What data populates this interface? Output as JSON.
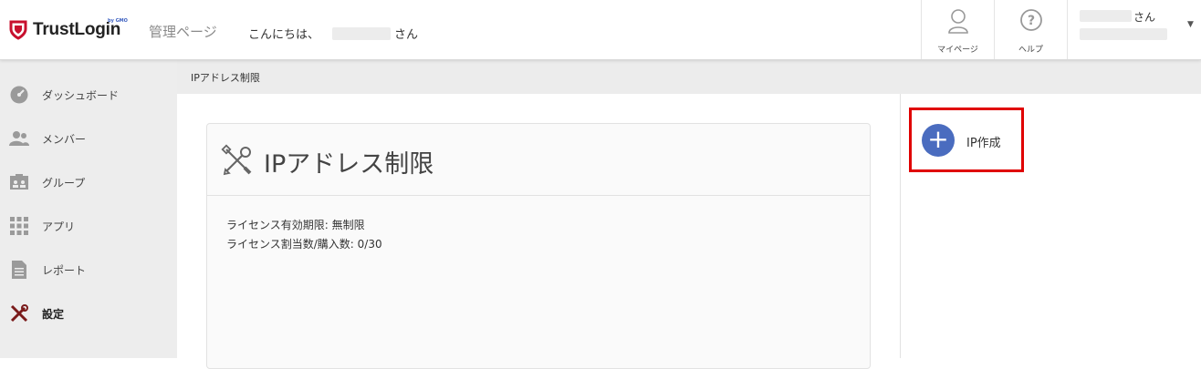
{
  "header": {
    "logo_text": "TrustLogin",
    "logo_sub": "by GMO",
    "admin_label": "管理ページ",
    "greeting_prefix": "こんにちは、",
    "greeting_suffix": "さん",
    "mypage_label": "マイページ",
    "help_label": "ヘルプ",
    "user_suffix": "さん"
  },
  "sidebar": {
    "items": [
      {
        "label": "ダッシュボード",
        "icon": "dashboard-icon"
      },
      {
        "label": "メンバー",
        "icon": "members-icon"
      },
      {
        "label": "グループ",
        "icon": "group-icon"
      },
      {
        "label": "アプリ",
        "icon": "apps-grid-icon"
      },
      {
        "label": "レポート",
        "icon": "report-icon"
      },
      {
        "label": "設定",
        "icon": "settings-tools-icon",
        "active": true
      }
    ]
  },
  "breadcrumb": "IPアドレス制限",
  "main": {
    "title": "IPアドレス制限",
    "license_period": "ライセンス有効期限: 無制限",
    "license_count": "ライセンス割当数/購入数: 0/30"
  },
  "actions": {
    "add_ip_label": "IP作成",
    "add_ip_icon": "+"
  },
  "colors": {
    "accent": "#4a6cbf",
    "highlight": "#e00000",
    "logo_red": "#c8102e",
    "sidebar_bg": "#ededed",
    "settings_icon": "#7a1b1b"
  }
}
